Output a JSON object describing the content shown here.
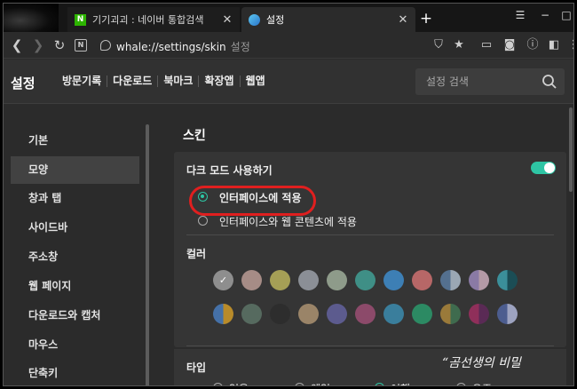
{
  "tabs": [
    {
      "title": "기기괴괴 : 네이버 통합검색",
      "favicon": "naver-n-icon",
      "active": false
    },
    {
      "title": "설정",
      "favicon": "whale-icon",
      "active": true
    }
  ],
  "tab_close_glyph": "✕",
  "new_tab_glyph": "+",
  "address": {
    "url": "whale://settings/skin",
    "suffix": "설정"
  },
  "settings": {
    "title": "설정",
    "top_nav": [
      "방문기록",
      "다운로드",
      "북마크",
      "확장앱",
      "웹앱"
    ],
    "search_placeholder": "설정 검색"
  },
  "sidebar": {
    "items": [
      {
        "label": "기본"
      },
      {
        "label": "모양",
        "active": true
      },
      {
        "label": "창과 탭"
      },
      {
        "label": "사이드바"
      },
      {
        "label": "주소창"
      },
      {
        "label": "웹 페이지"
      },
      {
        "label": "다운로드와 캡처"
      },
      {
        "label": "마우스"
      },
      {
        "label": "단축키"
      }
    ]
  },
  "content": {
    "section_title": "스킨",
    "dark_mode_label": "다크 모드 사용하기",
    "dark_mode_on": true,
    "options": [
      {
        "label": "인터페이스에 적용",
        "selected": true
      },
      {
        "label": "인터페이스와 웹 콘텐츠에 적용",
        "selected": false
      }
    ],
    "color_label": "컬러",
    "swatches": [
      {
        "c1": "#8e8e8e",
        "c2": "#8e8e8e",
        "selected": true
      },
      {
        "c1": "#a68c86",
        "c2": "#a68c86"
      },
      {
        "c1": "#a59f56",
        "c2": "#a59f56"
      },
      {
        "c1": "#8b8f96",
        "c2": "#8b8f96"
      },
      {
        "c1": "#8e9b8a",
        "c2": "#8e9b8a"
      },
      {
        "c1": "#3f8f86",
        "c2": "#3f8f86"
      },
      {
        "c1": "#3d7fb5",
        "c2": "#3d7fb5"
      },
      {
        "c1": "#b76767",
        "c2": "#b76767"
      },
      {
        "c1": "#54708f",
        "c2": "#9aa7b4"
      },
      {
        "c1": "#8a7aa5",
        "c2": "#b49aa6"
      },
      {
        "c1": "#3b8f9a",
        "c2": "#1b4d55"
      },
      {
        "c1": "#4571a8",
        "c2": "#b88b2a"
      },
      {
        "c1": "#566a5f",
        "c2": "#566a5f"
      },
      {
        "c1": "#2d2d2d",
        "c2": "#2d2d2d"
      },
      {
        "c1": "#9a8468",
        "c2": "#9a8468"
      },
      {
        "c1": "#5c5b8e",
        "c2": "#5c5b8e"
      },
      {
        "c1": "#8c4a6a",
        "c2": "#8c4a6a"
      },
      {
        "c1": "#3a7e9c",
        "c2": "#3a7e9c"
      },
      {
        "c1": "#2c8a63",
        "c2": "#2c8a63"
      },
      {
        "c1": "#9a7a3a",
        "c2": "#3f6b4e"
      },
      {
        "c1": "#8f2f5a",
        "c2": "#5a2a55"
      },
      {
        "c1": "#4c5d8f",
        "c2": "#9da3c0"
      }
    ],
    "type_label": "타입",
    "type_options": [
      "없음",
      "웨일",
      "여행",
      "우주"
    ],
    "type_selected": 2
  },
  "watermark": "“곰선생의 비밀",
  "colors": {
    "accent": "#2ec5a4",
    "highlight": "#e01f1f"
  }
}
